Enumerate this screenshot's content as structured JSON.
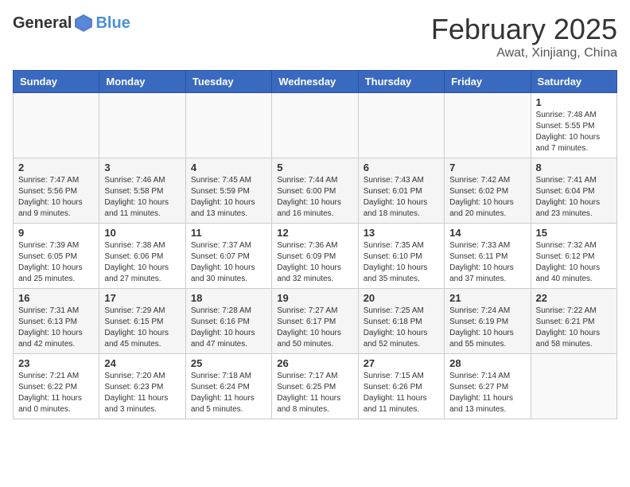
{
  "header": {
    "logo_general": "General",
    "logo_blue": "Blue",
    "month_title": "February 2025",
    "location": "Awat, Xinjiang, China"
  },
  "weekdays": [
    "Sunday",
    "Monday",
    "Tuesday",
    "Wednesday",
    "Thursday",
    "Friday",
    "Saturday"
  ],
  "weeks": [
    [
      {
        "day": "",
        "info": ""
      },
      {
        "day": "",
        "info": ""
      },
      {
        "day": "",
        "info": ""
      },
      {
        "day": "",
        "info": ""
      },
      {
        "day": "",
        "info": ""
      },
      {
        "day": "",
        "info": ""
      },
      {
        "day": "1",
        "info": "Sunrise: 7:48 AM\nSunset: 5:55 PM\nDaylight: 10 hours and 7 minutes."
      }
    ],
    [
      {
        "day": "2",
        "info": "Sunrise: 7:47 AM\nSunset: 5:56 PM\nDaylight: 10 hours and 9 minutes."
      },
      {
        "day": "3",
        "info": "Sunrise: 7:46 AM\nSunset: 5:58 PM\nDaylight: 10 hours and 11 minutes."
      },
      {
        "day": "4",
        "info": "Sunrise: 7:45 AM\nSunset: 5:59 PM\nDaylight: 10 hours and 13 minutes."
      },
      {
        "day": "5",
        "info": "Sunrise: 7:44 AM\nSunset: 6:00 PM\nDaylight: 10 hours and 16 minutes."
      },
      {
        "day": "6",
        "info": "Sunrise: 7:43 AM\nSunset: 6:01 PM\nDaylight: 10 hours and 18 minutes."
      },
      {
        "day": "7",
        "info": "Sunrise: 7:42 AM\nSunset: 6:02 PM\nDaylight: 10 hours and 20 minutes."
      },
      {
        "day": "8",
        "info": "Sunrise: 7:41 AM\nSunset: 6:04 PM\nDaylight: 10 hours and 23 minutes."
      }
    ],
    [
      {
        "day": "9",
        "info": "Sunrise: 7:39 AM\nSunset: 6:05 PM\nDaylight: 10 hours and 25 minutes."
      },
      {
        "day": "10",
        "info": "Sunrise: 7:38 AM\nSunset: 6:06 PM\nDaylight: 10 hours and 27 minutes."
      },
      {
        "day": "11",
        "info": "Sunrise: 7:37 AM\nSunset: 6:07 PM\nDaylight: 10 hours and 30 minutes."
      },
      {
        "day": "12",
        "info": "Sunrise: 7:36 AM\nSunset: 6:09 PM\nDaylight: 10 hours and 32 minutes."
      },
      {
        "day": "13",
        "info": "Sunrise: 7:35 AM\nSunset: 6:10 PM\nDaylight: 10 hours and 35 minutes."
      },
      {
        "day": "14",
        "info": "Sunrise: 7:33 AM\nSunset: 6:11 PM\nDaylight: 10 hours and 37 minutes."
      },
      {
        "day": "15",
        "info": "Sunrise: 7:32 AM\nSunset: 6:12 PM\nDaylight: 10 hours and 40 minutes."
      }
    ],
    [
      {
        "day": "16",
        "info": "Sunrise: 7:31 AM\nSunset: 6:13 PM\nDaylight: 10 hours and 42 minutes."
      },
      {
        "day": "17",
        "info": "Sunrise: 7:29 AM\nSunset: 6:15 PM\nDaylight: 10 hours and 45 minutes."
      },
      {
        "day": "18",
        "info": "Sunrise: 7:28 AM\nSunset: 6:16 PM\nDaylight: 10 hours and 47 minutes."
      },
      {
        "day": "19",
        "info": "Sunrise: 7:27 AM\nSunset: 6:17 PM\nDaylight: 10 hours and 50 minutes."
      },
      {
        "day": "20",
        "info": "Sunrise: 7:25 AM\nSunset: 6:18 PM\nDaylight: 10 hours and 52 minutes."
      },
      {
        "day": "21",
        "info": "Sunrise: 7:24 AM\nSunset: 6:19 PM\nDaylight: 10 hours and 55 minutes."
      },
      {
        "day": "22",
        "info": "Sunrise: 7:22 AM\nSunset: 6:21 PM\nDaylight: 10 hours and 58 minutes."
      }
    ],
    [
      {
        "day": "23",
        "info": "Sunrise: 7:21 AM\nSunset: 6:22 PM\nDaylight: 11 hours and 0 minutes."
      },
      {
        "day": "24",
        "info": "Sunrise: 7:20 AM\nSunset: 6:23 PM\nDaylight: 11 hours and 3 minutes."
      },
      {
        "day": "25",
        "info": "Sunrise: 7:18 AM\nSunset: 6:24 PM\nDaylight: 11 hours and 5 minutes."
      },
      {
        "day": "26",
        "info": "Sunrise: 7:17 AM\nSunset: 6:25 PM\nDaylight: 11 hours and 8 minutes."
      },
      {
        "day": "27",
        "info": "Sunrise: 7:15 AM\nSunset: 6:26 PM\nDaylight: 11 hours and 11 minutes."
      },
      {
        "day": "28",
        "info": "Sunrise: 7:14 AM\nSunset: 6:27 PM\nDaylight: 11 hours and 13 minutes."
      },
      {
        "day": "",
        "info": ""
      }
    ]
  ]
}
